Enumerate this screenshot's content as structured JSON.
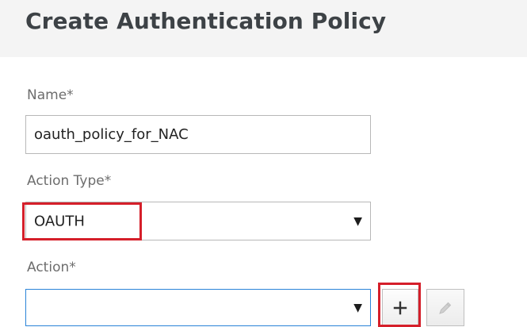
{
  "title": "Create Authentication Policy",
  "fields": {
    "name": {
      "label": "Name*",
      "value": "oauth_policy_for_NAC"
    },
    "action_type": {
      "label": "Action Type*",
      "selected": "OAUTH"
    },
    "action": {
      "label": "Action*",
      "selected": ""
    }
  },
  "icons": {
    "dropdown": "caret-down-icon",
    "add": "plus-icon",
    "edit": "pencil-icon"
  },
  "colors": {
    "highlight": "#d51f2a",
    "focus": "#2a84d8",
    "title": "#3d4246",
    "label": "#6d6d6d"
  }
}
